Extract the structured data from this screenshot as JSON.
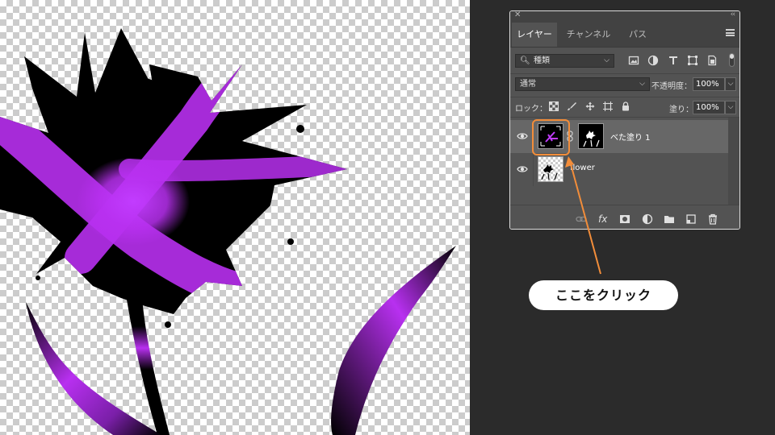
{
  "panel": {
    "tabs": [
      {
        "label": "レイヤー",
        "active": true
      },
      {
        "label": "チャンネル",
        "active": false
      },
      {
        "label": "パス",
        "active": false
      }
    ],
    "filter": {
      "label": "種類"
    },
    "blend_mode": "通常",
    "opacity": {
      "label": "不透明度：",
      "value": "100%"
    },
    "lock": {
      "label": "ロック："
    },
    "fill": {
      "label": "塗り：",
      "value": "100%"
    },
    "layers": [
      {
        "name": "べた塗り 1",
        "selected": true,
        "visible": true,
        "kind": "fill-layer-with-mask"
      },
      {
        "name": "flower",
        "selected": false,
        "visible": true,
        "kind": "pixel-layer"
      }
    ],
    "bottom_icons": [
      "link-icon",
      "fx-icon",
      "mask-icon",
      "adjustment-icon",
      "folder-icon",
      "new-layer-icon",
      "trash-icon"
    ],
    "fx_label": "fx"
  },
  "annotation": {
    "text": "ここをクリック",
    "color": "#f28d3a"
  },
  "colors": {
    "accent": "#f28d3a",
    "flower_purple": "#b830f0",
    "panel_bg": "#535353"
  }
}
